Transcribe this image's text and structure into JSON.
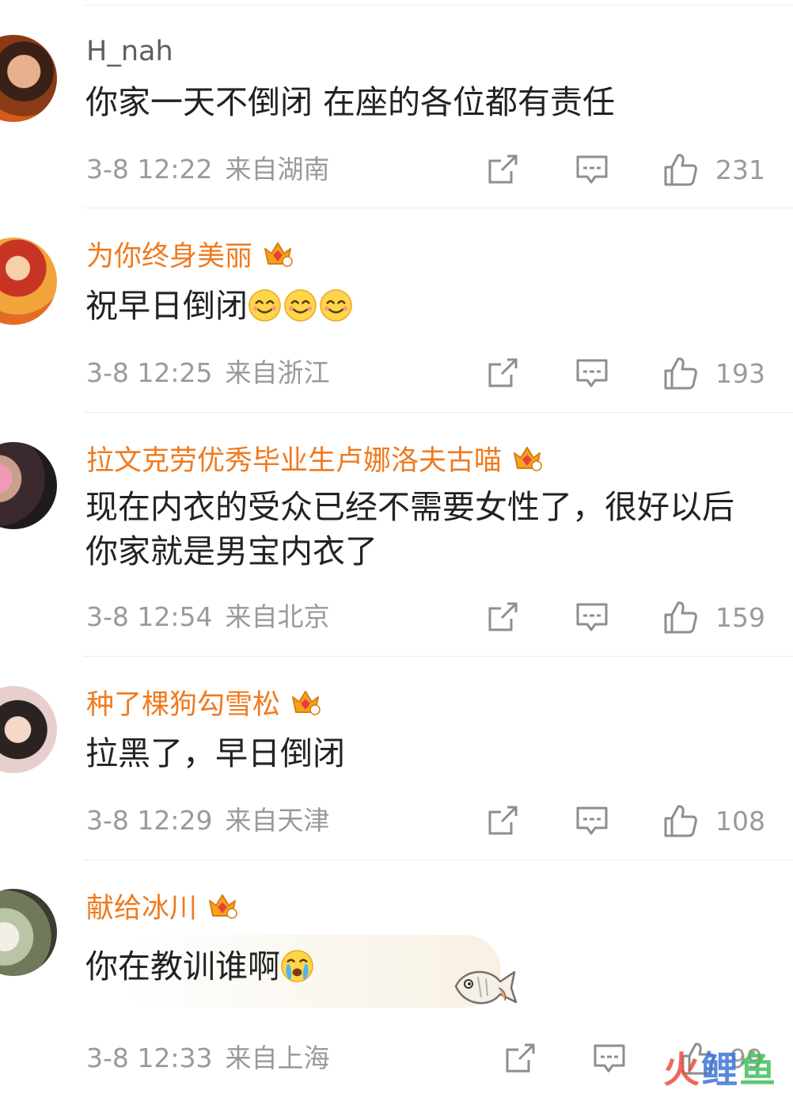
{
  "comments": [
    {
      "username": "H_nah",
      "vip": false,
      "text": "你家一天不倒闭 在座的各位都有责任",
      "time": "3-8 12:22",
      "location": "来自湖南",
      "likes": "231"
    },
    {
      "username": "为你终身美丽",
      "vip": true,
      "text": "祝早日倒闭",
      "time": "3-8 12:25",
      "location": "来自浙江",
      "likes": "193"
    },
    {
      "username": "拉文克劳优秀毕业生卢娜洛夫古喵",
      "vip": true,
      "text": "现在内衣的受众已经不需要女性了，很好以后你家就是男宝内衣了",
      "time": "3-8 12:54",
      "location": "来自北京",
      "likes": "159"
    },
    {
      "username": "种了棵狗勾雪松",
      "vip": true,
      "text": "拉黑了，早日倒闭",
      "time": "3-8 12:29",
      "location": "来自天津",
      "likes": "108"
    },
    {
      "username": "献给冰川",
      "vip": true,
      "text": "你在教训谁啊",
      "time": "3-8 12:33",
      "location": "来自上海",
      "likes": "99"
    }
  ],
  "icons": {
    "repost": "repost-icon",
    "comment": "comment-icon",
    "like": "thumbs-up-icon",
    "badge": "crown-badge-icon",
    "emoji_smile": "smile-emoji-icon",
    "emoji_cry": "crying-emoji-icon"
  },
  "colors": {
    "vip_name": "#f07a1f",
    "plain_name": "#5f5f5f",
    "meta": "#9a9a9a",
    "body_text": "#222222"
  },
  "watermark": {
    "part1": "火",
    "part2": "鲤",
    "part3": "鱼"
  }
}
